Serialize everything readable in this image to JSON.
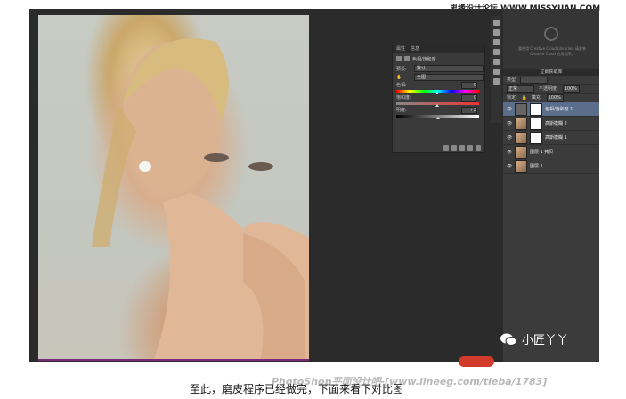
{
  "watermarks": {
    "site": "思缘设计论坛 WWW.MISSYUAN.COM",
    "bottom": "PhotoShop平面设计吧-[www.lineeg.com/tieba/1783]",
    "wechat": "小匠丫丫"
  },
  "caption": "至此，磨皮程序已经做完，下面来看下对比图",
  "properties_panel": {
    "tabs": [
      "属性",
      "信息"
    ],
    "title": "色相/饱和度",
    "preset_label": "预设:",
    "preset_value": "默认",
    "channel_value": "全图",
    "sliders": [
      {
        "label": "色相:",
        "value": "0"
      },
      {
        "label": "饱和度:",
        "value": "0"
      },
      {
        "label": "明度:",
        "value": "+2"
      }
    ]
  },
  "right_panel": {
    "library_text": "要使用 Creative Cloud Libraries, 请安装 Creative Cloud 应用程序。",
    "library_button": "立即获取库",
    "blend_mode": "正常",
    "opacity_label": "不透明度:",
    "opacity_value": "100%",
    "fill_label": "填充:",
    "fill_value": "100%",
    "lock_label": "锁定:",
    "kind_label": "类型",
    "layers": [
      {
        "name": "色相/饱和度 1",
        "selected": true,
        "thumb": "adjustment"
      },
      {
        "name": "高斯模糊 2",
        "selected": false,
        "thumb": "mask"
      },
      {
        "name": "高斯模糊 1",
        "selected": false,
        "thumb": "mask"
      },
      {
        "name": "图层 1 拷贝",
        "selected": false,
        "thumb": "photo"
      },
      {
        "name": "图层 1",
        "selected": false,
        "thumb": "photo"
      }
    ]
  },
  "colors": {
    "panel_bg": "#3b3b3b",
    "canvas_bg": "#2b2b2b",
    "selected_layer": "#5a6e8c"
  }
}
